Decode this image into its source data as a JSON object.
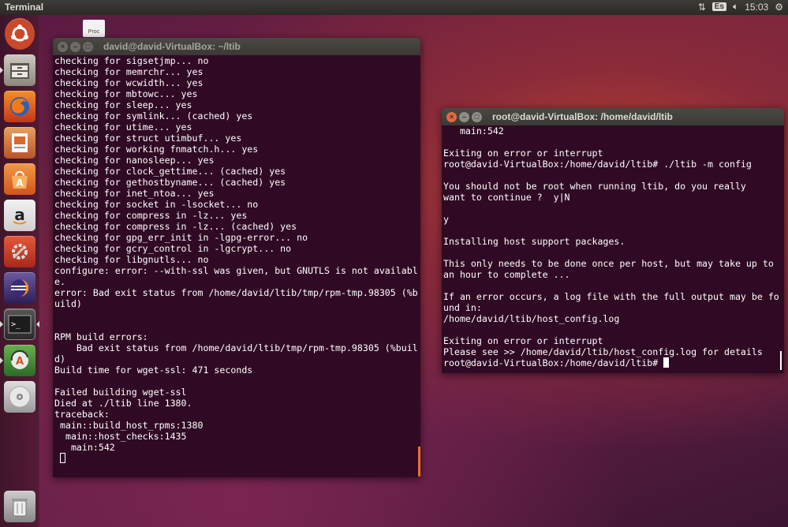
{
  "panel": {
    "app_title": "Terminal",
    "keyboard_layout": "Es",
    "clock": "15:03"
  },
  "launcher": {
    "items": [
      {
        "name": "dash-icon"
      },
      {
        "name": "files-icon"
      },
      {
        "name": "firefox-icon"
      },
      {
        "name": "impress-icon"
      },
      {
        "name": "software-center-icon"
      },
      {
        "name": "amazon-icon"
      },
      {
        "name": "system-settings-icon"
      },
      {
        "name": "eclipse-icon"
      },
      {
        "name": "terminal-icon"
      },
      {
        "name": "software-updater-icon"
      },
      {
        "name": "dvd-icon"
      },
      {
        "name": "trash-icon"
      }
    ]
  },
  "desktop": {
    "file_label": "Proc"
  },
  "term_left": {
    "title": "david@david-VirtualBox: ~/ltib",
    "lines": [
      "checking for sigsetjmp... no",
      "checking for memrchr... yes",
      "checking for wcwidth... yes",
      "checking for mbtowc... yes",
      "checking for sleep... yes",
      "checking for symlink... (cached) yes",
      "checking for utime... yes",
      "checking for struct utimbuf... yes",
      "checking for working fnmatch.h... yes",
      "checking for nanosleep... yes",
      "checking for clock_gettime... (cached) yes",
      "checking for gethostbyname... (cached) yes",
      "checking for inet_ntoa... yes",
      "checking for socket in -lsocket... no",
      "checking for compress in -lz... yes",
      "checking for compress in -lz... (cached) yes",
      "checking for gpg_err_init in -lgpg-error... no",
      "checking for gcry_control in -lgcrypt... no",
      "checking for libgnutls... no",
      "configure: error: --with-ssl was given, but GNUTLS is not availabl",
      "e.",
      "error: Bad exit status from /home/david/ltib/tmp/rpm-tmp.98305 (%b",
      "uild)",
      "",
      "",
      "RPM build errors:",
      "    Bad exit status from /home/david/ltib/tmp/rpm-tmp.98305 (%buil",
      "d)",
      "Build time for wget-ssl: 471 seconds",
      "",
      "Failed building wget-ssl",
      "Died at ./ltib line 1380.",
      "traceback:",
      " main::build_host_rpms:1380",
      "  main::host_checks:1435",
      "   main:542",
      ""
    ]
  },
  "term_right": {
    "title": "root@david-VirtualBox: /home/david/ltib",
    "lines": [
      "   main:542",
      "",
      "Exiting on error or interrupt",
      "root@david-VirtualBox:/home/david/ltib# ./ltib -m config",
      "",
      "You should not be root when running ltib, do you really",
      "want to continue ?  y|N",
      "",
      "y",
      "",
      "Installing host support packages.",
      "",
      "This only needs to be done once per host, but may take up to",
      "an hour to complete ...",
      "",
      "If an error occurs, a log file with the full output may be fo",
      "und in:",
      "/home/david/ltib/host_config.log",
      "",
      "Exiting on error or interrupt",
      "Please see >> /home/david/ltib/host_config.log for details",
      "root@david-VirtualBox:/home/david/ltib# "
    ]
  },
  "colors": {
    "terminal_bg": "#300a24",
    "accent": "#e8712c"
  }
}
